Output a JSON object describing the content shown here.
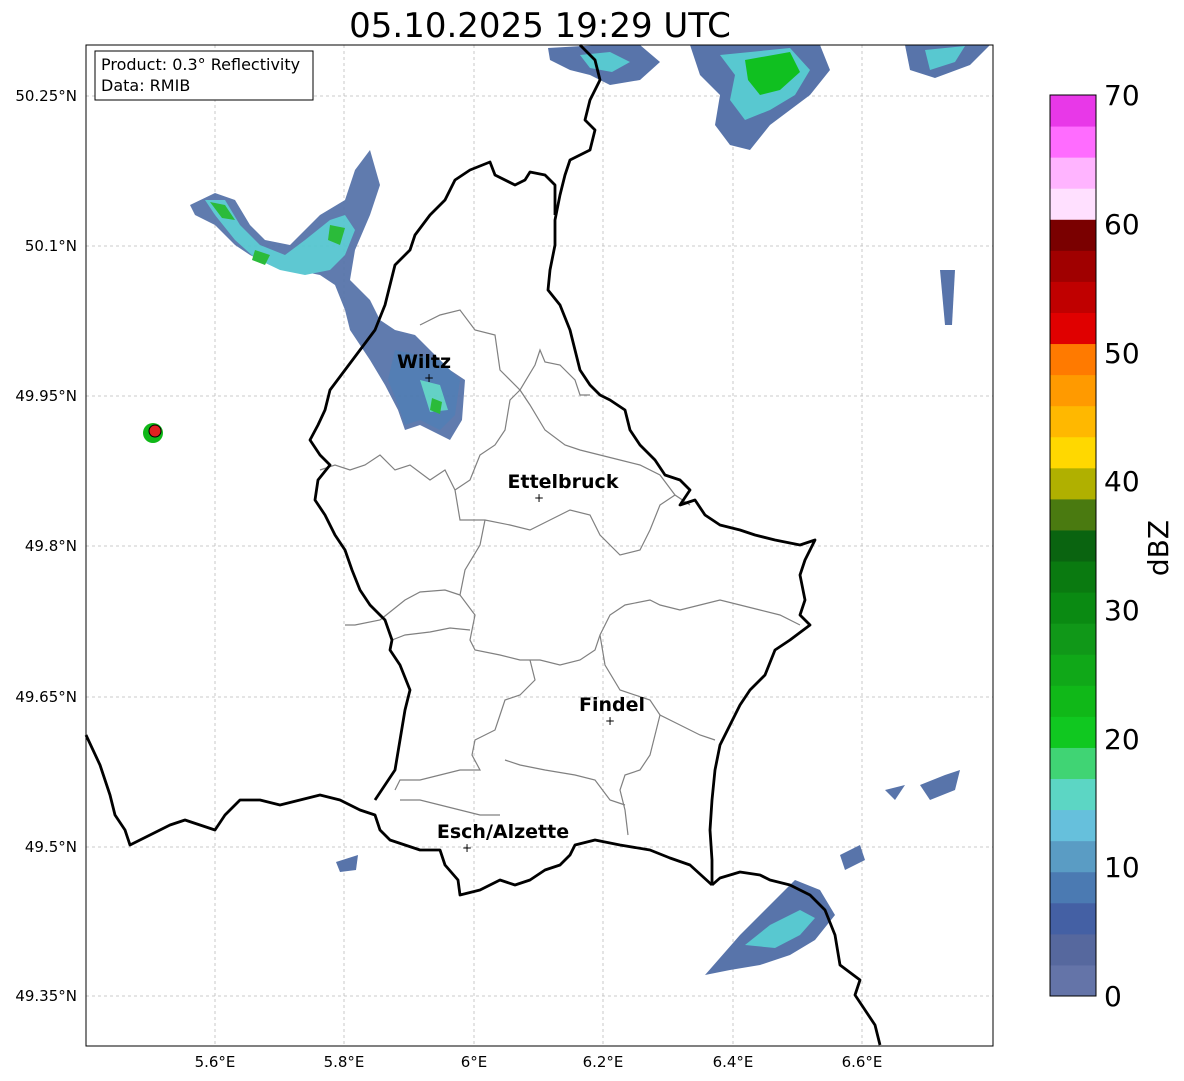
{
  "title": "05.10.2025 19:29 UTC",
  "infobox": {
    "line1": "Product: 0.3° Reflectivity",
    "line2": "Data: RMIB"
  },
  "lat_ticks": [
    "50.25°N",
    "50.1°N",
    "49.95°N",
    "49.8°N",
    "49.65°N",
    "49.5°N",
    "49.35°N"
  ],
  "lon_ticks": [
    "5.6°E",
    "5.8°E",
    "6°E",
    "6.2°E",
    "6.4°E",
    "6.6°E"
  ],
  "cities": [
    {
      "name": "Wiltz"
    },
    {
      "name": "Ettelbruck"
    },
    {
      "name": "Findel"
    },
    {
      "name": "Esch/Alzette"
    }
  ],
  "colorbar": {
    "label": "dBZ",
    "ticks": [
      "0",
      "10",
      "20",
      "30",
      "40",
      "50",
      "60",
      "70"
    ],
    "colors": [
      "#6474a8",
      "#56689e",
      "#4460a4",
      "#4b7ab2",
      "#5a9cc4",
      "#66c0dc",
      "#5cd6c4",
      "#40d474",
      "#10c820",
      "#10b818",
      "#10a818",
      "#109818",
      "#0a8a12",
      "#0a7a10",
      "#0a6410",
      "#4a7a10",
      "#b0b000",
      "#ffd800",
      "#ffb800",
      "#ff9a00",
      "#ff7a00",
      "#e00000",
      "#c00000",
      "#a00000",
      "#7a0000",
      "#ffe0ff",
      "#ffb4ff",
      "#ff6cff",
      "#e838e8"
    ]
  },
  "colors": {
    "border": "#000000",
    "cantons": "#808080",
    "grid": "#bbbbbb",
    "radar_site": "#e02020"
  }
}
